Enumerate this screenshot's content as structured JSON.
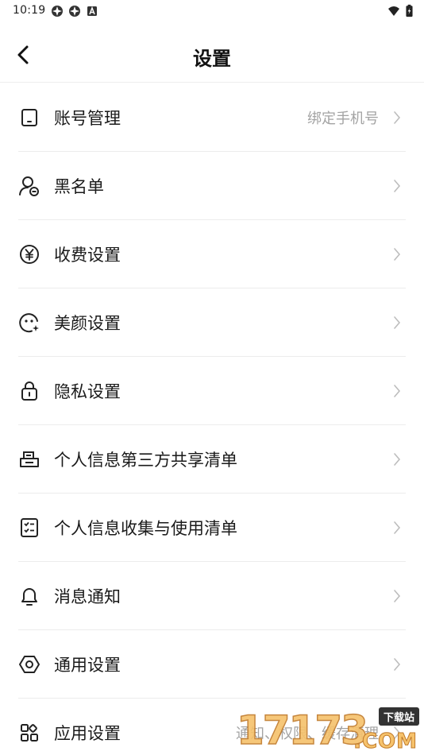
{
  "status_bar": {
    "time": "10:19",
    "left_icons": [
      "app-icon",
      "app-icon",
      "notification-a-icon"
    ],
    "right_icons": [
      "wifi-icon",
      "battery-charging-icon"
    ]
  },
  "header": {
    "title": "设置",
    "back_icon": "chevron-left-icon"
  },
  "settings": [
    {
      "icon": "phone-icon",
      "label": "账号管理",
      "value": "绑定手机号"
    },
    {
      "icon": "user-block-icon",
      "label": "黑名单",
      "value": ""
    },
    {
      "icon": "yen-icon",
      "label": "收费设置",
      "value": ""
    },
    {
      "icon": "face-beauty-icon",
      "label": "美颜设置",
      "value": ""
    },
    {
      "icon": "lock-icon",
      "label": "隐私设置",
      "value": ""
    },
    {
      "icon": "share-list-icon",
      "label": "个人信息第三方共享清单",
      "value": ""
    },
    {
      "icon": "checklist-icon",
      "label": "个人信息收集与使用清单",
      "value": ""
    },
    {
      "icon": "bell-icon",
      "label": "消息通知",
      "value": ""
    },
    {
      "icon": "hexagon-gear-icon",
      "label": "通用设置",
      "value": ""
    },
    {
      "icon": "apps-grid-icon",
      "label": "应用设置",
      "value": "通知、权限、缓存清理"
    }
  ],
  "watermark": {
    "number": "17173",
    "badge": "下载站",
    "domain": ".COM"
  },
  "colors": {
    "text_primary": "#1a1a1a",
    "text_secondary": "#a3a3a3",
    "divider": "#ececec",
    "background": "#ffffff"
  }
}
